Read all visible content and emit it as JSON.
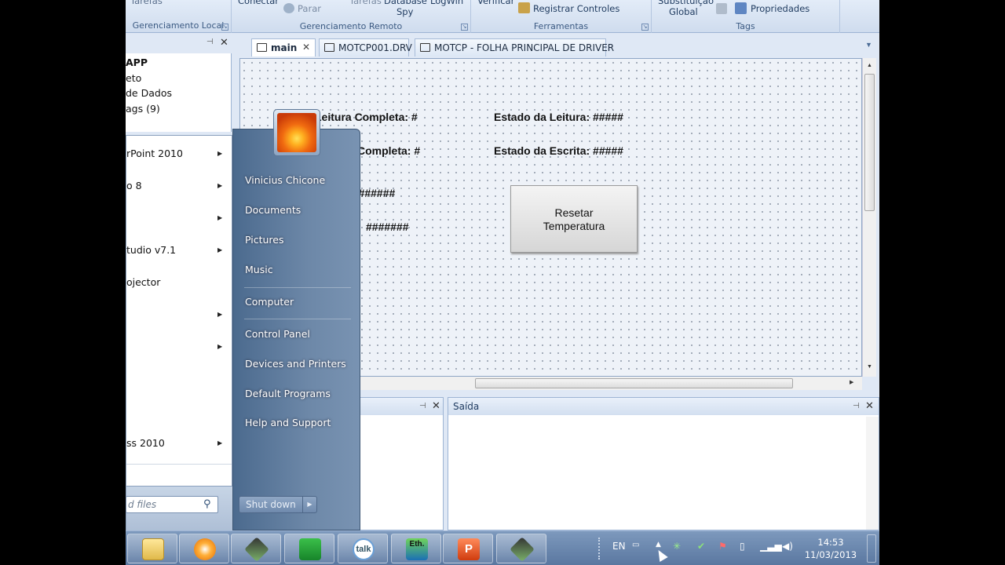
{
  "ribbon": {
    "top_partial": {
      "tarefas": "Tarefas",
      "conectar": "Conectar",
      "tarefas2": "Tarefas",
      "database_spy": "Database",
      "logwin": "LogWin",
      "verificar": "Verificar",
      "substituicao": "Substituição"
    },
    "parar": "Parar",
    "spy": "Spy",
    "registrar": "Registrar Controles",
    "global": "Global",
    "propriedades": "Propriedades",
    "groups": {
      "local": "Gerenciamento Local",
      "remoto": "Gerenciamento Remoto",
      "ferramentas": "Ferramentas",
      "tags": "Tags"
    }
  },
  "tree": {
    "items": [
      "APP",
      "eto",
      "de Dados",
      "ags (9)"
    ]
  },
  "tabs": [
    {
      "label": "main"
    },
    {
      "label": "MOTCP001.DRV"
    },
    {
      "label": "MOTCP - FOLHA PRINCIPAL DE DRIVER"
    }
  ],
  "canvas": {
    "leitura_completa": "Leitura Completa: #",
    "escrita_completa": "Completa: #",
    "estado_leitura": "Estado da Leitura: #####",
    "estado_escrita": "Estado da Escrita: #####",
    "temperatura": "atura: #######",
    "pressao": "#######",
    "reset_button": "Resetar\nTemperatura",
    "reset_line1": "Resetar",
    "reset_line2": "Temperatura"
  },
  "panels": {
    "saida": "Saída"
  },
  "start_menu": {
    "programs": [
      {
        "label": "rPoint 2010",
        "has_submenu": true
      },
      {
        "label": "o 8",
        "has_submenu": true
      },
      {
        "label": "",
        "has_submenu": true
      },
      {
        "label": "tudio v7.1",
        "has_submenu": true
      },
      {
        "label": "ojector",
        "has_submenu": false
      },
      {
        "label": "",
        "has_submenu": true
      },
      {
        "label": "",
        "has_submenu": true
      },
      {
        "label": "ss 2010",
        "has_submenu": true
      }
    ],
    "right": {
      "user": "Vinicius Chicone",
      "documents": "Documents",
      "pictures": "Pictures",
      "music": "Music",
      "computer": "Computer",
      "control_panel": "Control Panel",
      "devices": "Devices and Printers",
      "default_programs": "Default Programs",
      "help": "Help and Support"
    },
    "search_placeholder": "d files",
    "shutdown": "Shut down"
  },
  "taskbar": {
    "apps": [
      "folder-icon",
      "media-player-icon",
      "app-icon",
      "cubes-icon",
      "gtalk-icon",
      "ethernet-icon",
      "powerpoint-icon",
      "app2-icon"
    ],
    "talk_label": "talk",
    "eth_label": "Eth.",
    "lang": "EN",
    "time": "14:53",
    "date": "11/03/2013"
  }
}
